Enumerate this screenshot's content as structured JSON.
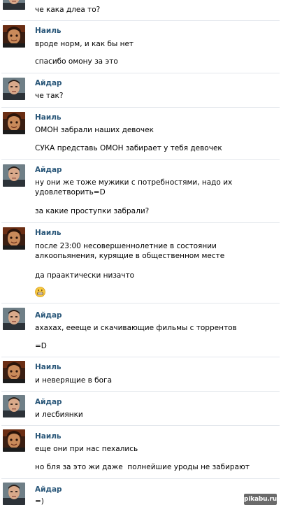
{
  "messages": [
    {
      "sender": "",
      "avatar": "aydar-avatar",
      "lines": [
        "че кака длеа то?"
      ]
    },
    {
      "sender": "Наиль",
      "avatar": "nail-avatar",
      "lines": [
        "вроде норм, и как бы нет",
        "спасибо омону за это"
      ]
    },
    {
      "sender": "Айдар",
      "avatar": "aydar-avatar",
      "lines": [
        "че так?"
      ]
    },
    {
      "sender": "Наиль",
      "avatar": "nail-avatar",
      "lines": [
        "ОМОН забрали наших девочек",
        "СУКА представь ОМОН забирает у тебя девочек"
      ]
    },
    {
      "sender": "Айдар",
      "avatar": "aydar-avatar",
      "lines": [
        "ну они же тоже мужики с потребностями, надо их удовлетворить=D",
        "за какие проступки забрали?"
      ]
    },
    {
      "sender": "Наиль",
      "avatar": "nail-avatar",
      "lines": [
        "после 23:00 несовершеннолетние в состоянии алкоопьянения, курящие в общественном месте",
        "да праактически низачто"
      ],
      "emoji": "grinning-emoji"
    },
    {
      "sender": "Айдар",
      "avatar": "aydar-avatar",
      "lines": [
        "ахахах, еееще и скачивающие фильмы с торрентов",
        "=D"
      ]
    },
    {
      "sender": "Наиль",
      "avatar": "nail-avatar",
      "lines": [
        "и неверящие в бога"
      ]
    },
    {
      "sender": "Айдар",
      "avatar": "aydar-avatar",
      "lines": [
        "и лесбиянки"
      ]
    },
    {
      "sender": "Наиль",
      "avatar": "nail-avatar",
      "lines": [
        "еще они при нас пехались",
        "но бля за это жи даже  полнейшие уроды не забирают"
      ]
    },
    {
      "sender": "Айдар",
      "avatar": "aydar-avatar",
      "lines": [
        "=)"
      ]
    }
  ],
  "watermark": "pikabu.ru",
  "colors": {
    "sender_name": "#2b587a",
    "separator": "#e3e7ec"
  }
}
